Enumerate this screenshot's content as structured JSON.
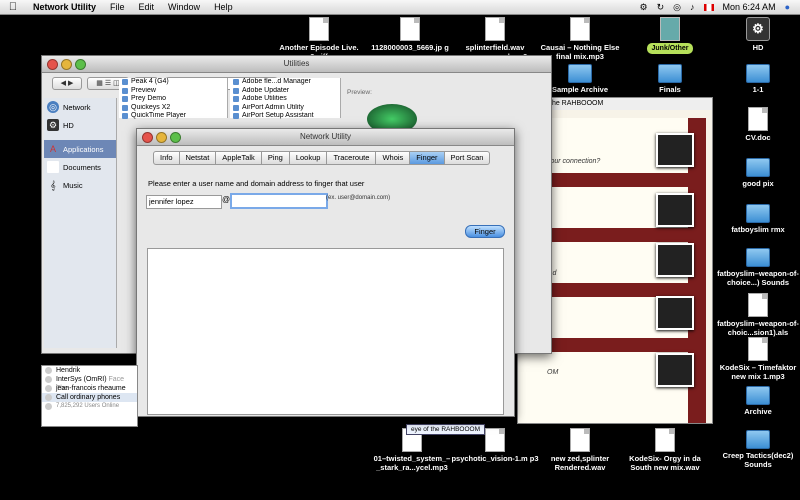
{
  "menubar": {
    "app": "Network Utility",
    "items": [
      "File",
      "Edit",
      "Window",
      "Help"
    ],
    "clock": "Mon 6:24 AM"
  },
  "desktop_icons": {
    "episode": "Another Episode Live. 2.aiff",
    "jpg": "1128000003_5669.jp g",
    "splinter": "splinterfield.wav paqan_...ycel.mp3",
    "causai": "Causai – Nothing Else final mix.mp3",
    "junk": "Junk/Other",
    "hd": "HD",
    "sample": "Sample Archive",
    "finals": "Finals",
    "one": "1-1",
    "cv": "CV.doc",
    "goodpix": "good pix",
    "fatboy": "fatboyslim rmx",
    "fatboy2": "fatboyslim–weapon-of-choice...) Sounds",
    "fatboy3": "fatboyslim–weapon-of-choic...sion1).als",
    "kode1": "KodeSix – Timefaktor new mix 1.mp3",
    "archive": "Archive",
    "creep": "Creep Tactics(dec2) Sounds",
    "twisted": "01–twisted_system_–_stark_ra...ycel.mp3",
    "psychotic": "psychotic_vision-1.m p3",
    "newzed": "new zed,splinter Rendered.wav",
    "kode2": "KodeSix- Orgy in da South new mix.wav"
  },
  "utilities": {
    "title": "Utilities",
    "search_placeholder": "",
    "sidebar": [
      {
        "label": "Network",
        "icon": "globe-icon"
      },
      {
        "label": "HD",
        "icon": "disk-icon"
      },
      {
        "label": "Applications",
        "icon": "applications-icon"
      },
      {
        "label": "Documents",
        "icon": "documents-icon"
      },
      {
        "label": "Music",
        "icon": "music-icon"
      }
    ],
    "col1": [
      "Peak 4 (G4)",
      "Preview",
      "Prey Demo",
      "Quickeys X2",
      "QuickTime Player"
    ],
    "col2": [
      "Adobe fle...d Manager",
      "Adobe Updater",
      "Adobe Utilities",
      "AirPort Admin Utility",
      "AirPort Setup Assistant"
    ],
    "preview": "Preview:"
  },
  "network_utility": {
    "title": "Network Utility",
    "tabs": [
      "Info",
      "Netstat",
      "AppleTalk",
      "Ping",
      "Lookup",
      "Traceroute",
      "Whois",
      "Finger",
      "Port Scan"
    ],
    "selected_tab": "Finger",
    "prompt": "Please enter a user name and domain address to finger that user",
    "user_value": "jennifer lopez",
    "at": "@",
    "domain_value": "",
    "hint": "(ex. user@domain.com)",
    "button": "Finger"
  },
  "blog": {
    "title": "the RAHBOOOM",
    "lines": [
      "your connection?",
      "ind",
      "OM"
    ],
    "tab": "eye of the RAHBOOOM"
  },
  "buddy": {
    "names": [
      "Hendrik",
      "InterSys (OmRI)",
      "jean-francois rheaume"
    ],
    "status": "Face The",
    "footer": "Call ordinary phones",
    "online": "7,825,292 Users Online"
  },
  "colors": {
    "accent": "#5b9ae0",
    "desktop": "#000000",
    "blog_stripe": "#7a1d1d"
  }
}
